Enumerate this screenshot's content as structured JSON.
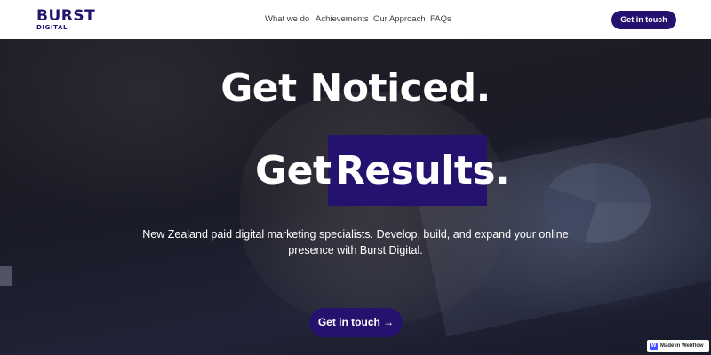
{
  "brand": {
    "name": "BURST",
    "sub": "DIGITAL",
    "color": "#24126e"
  },
  "nav": {
    "links": [
      "What we do",
      "Achievements",
      "Our Approach",
      "FAQs"
    ],
    "cta": "Get in touch"
  },
  "hero": {
    "line1": "Get Noticed.",
    "line2_prefix": "Get",
    "line2_highlight": "Results.",
    "subtext": "New Zealand paid digital marketing specialists. Develop, build, and expand your online presence with Burst Digital.",
    "cta": "Get in touch →",
    "highlight_color": "#24126e"
  },
  "badge": {
    "text": "Made in Webflow",
    "icon": "webflow-icon"
  }
}
